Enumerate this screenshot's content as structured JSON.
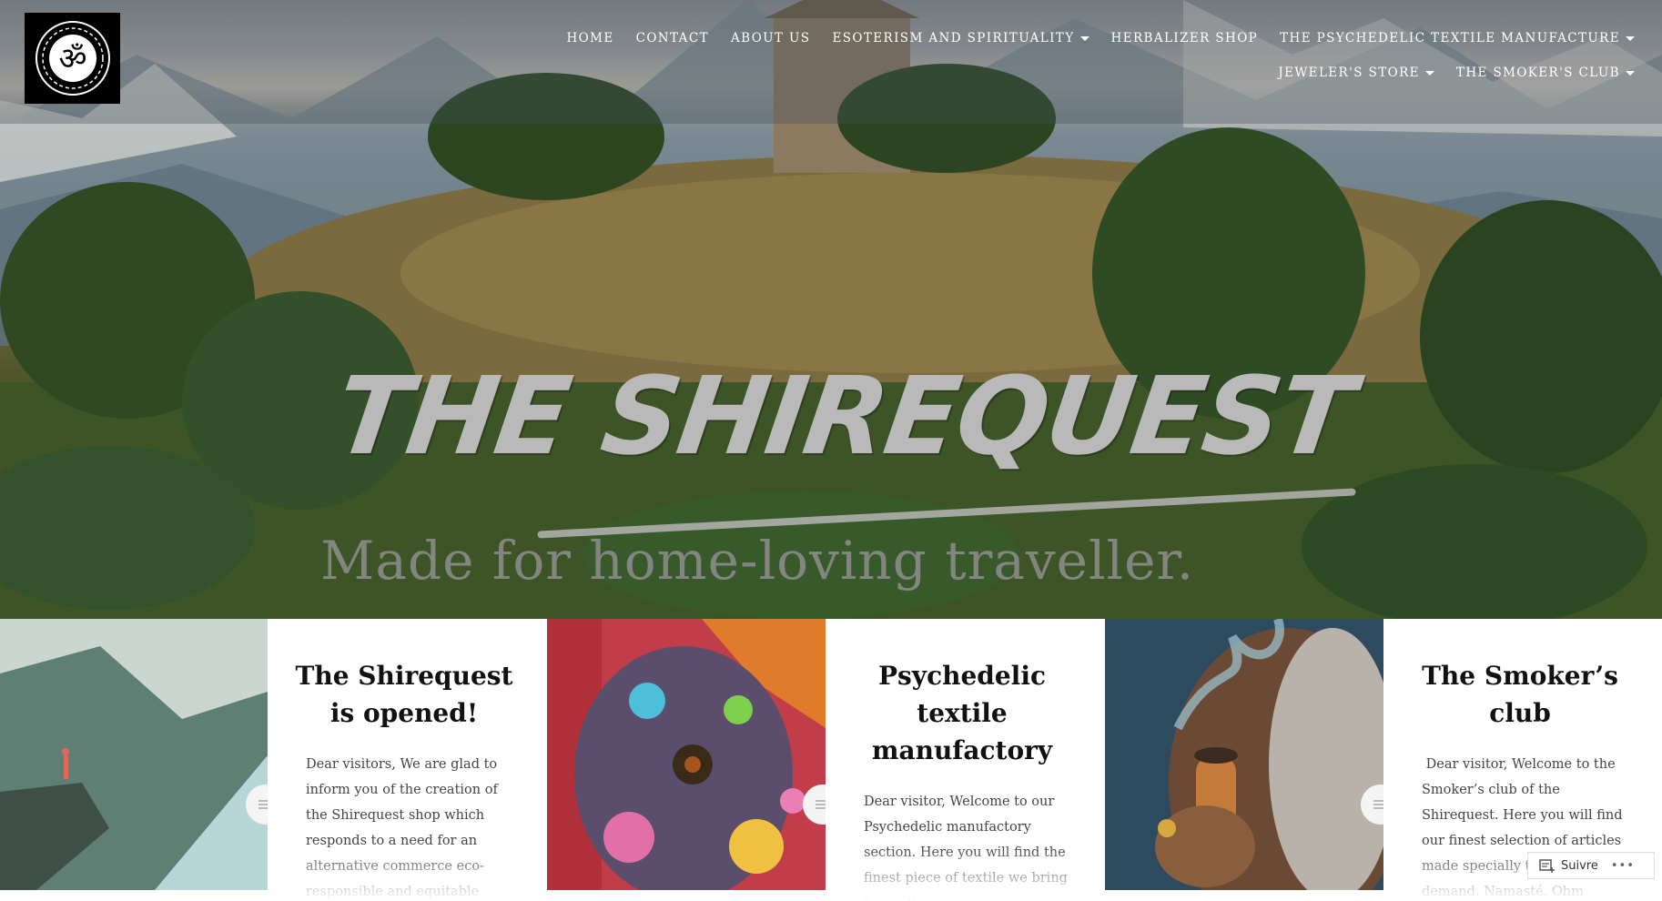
{
  "header": {
    "logo_icon": "om-mandala-icon",
    "nav": [
      {
        "label": "HOME",
        "dropdown": false
      },
      {
        "label": "CONTACT",
        "dropdown": false
      },
      {
        "label": "ABOUT US",
        "dropdown": false
      },
      {
        "label": "ESOTERISM AND SPIRITUALITY",
        "dropdown": true
      },
      {
        "label": "HERBALIZER SHOP",
        "dropdown": false
      },
      {
        "label": "THE PSYCHEDELIC TEXTILE MANUFACTURE",
        "dropdown": true
      },
      {
        "label": "JEWELER'S STORE",
        "dropdown": true
      },
      {
        "label": "THE SMOKER'S CLUB",
        "dropdown": true
      }
    ]
  },
  "hero": {
    "title": "THE SHIREQUEST",
    "subtitle": "Made for home-loving traveller."
  },
  "posts": [
    {
      "title": "The Shirequest is opened!",
      "excerpt": "Dear visitors, We are glad to inform you of the creation of the Shirequest shop which responds to a need for an alternative commerce eco-responsible and equitable commerce made to"
    },
    {
      "title": "Psychedelic textile manufactory",
      "excerpt": "Dear visitor, Welcome to our Psychedelic manufactory section. Here you will find the finest piece of textile we bring from all over"
    },
    {
      "title": "The Smoker’s club",
      "excerpt": " Dear visitor, Welcome to the Smoker’s club of the Shirequest. Here you will find our finest selection of articles made specially to respond demand. Namasté. Ohm"
    }
  ],
  "follow_button": {
    "label": "Suivre",
    "more": "•••"
  }
}
